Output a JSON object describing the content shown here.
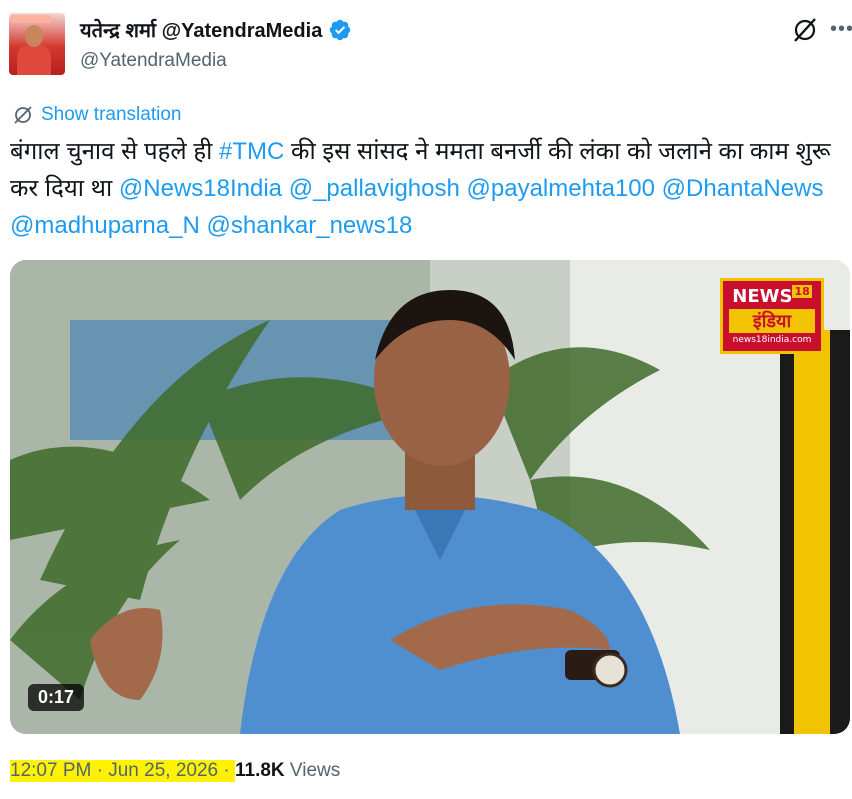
{
  "author": {
    "display_name": "यतेन्द्र शर्मा @YatendraMedia",
    "handle": "@YatendraMedia"
  },
  "translate": {
    "label": "Show translation"
  },
  "tweet": {
    "text_line1": "बंगाल चुनाव से पहले ही ",
    "hashtag": "#TMC",
    "text_line1_rest": " की इस सांसद ने ममता बनर्जी की लंका को जलाने का काम शुरू कर दिया था ",
    "mentions": [
      "@News18India",
      "@_pallavighosh",
      "@payalmehta100",
      "@DhantaNews",
      "@madhuparna_N",
      "@shankar_news18"
    ]
  },
  "media": {
    "duration": "0:17",
    "logo_top": "NEWS",
    "logo_num": "18",
    "logo_mid": "इंडिया",
    "logo_url": "news18india.com"
  },
  "meta": {
    "time": "12:07 PM",
    "sep1": " · ",
    "date": "Jun 25, 2026",
    "sep2": " · ",
    "views_count": "11.8K",
    "views_label": " Views"
  },
  "colors": {
    "link": "#1d9bf0",
    "verified": "#1d9bf0",
    "highlight": "#fff200"
  }
}
